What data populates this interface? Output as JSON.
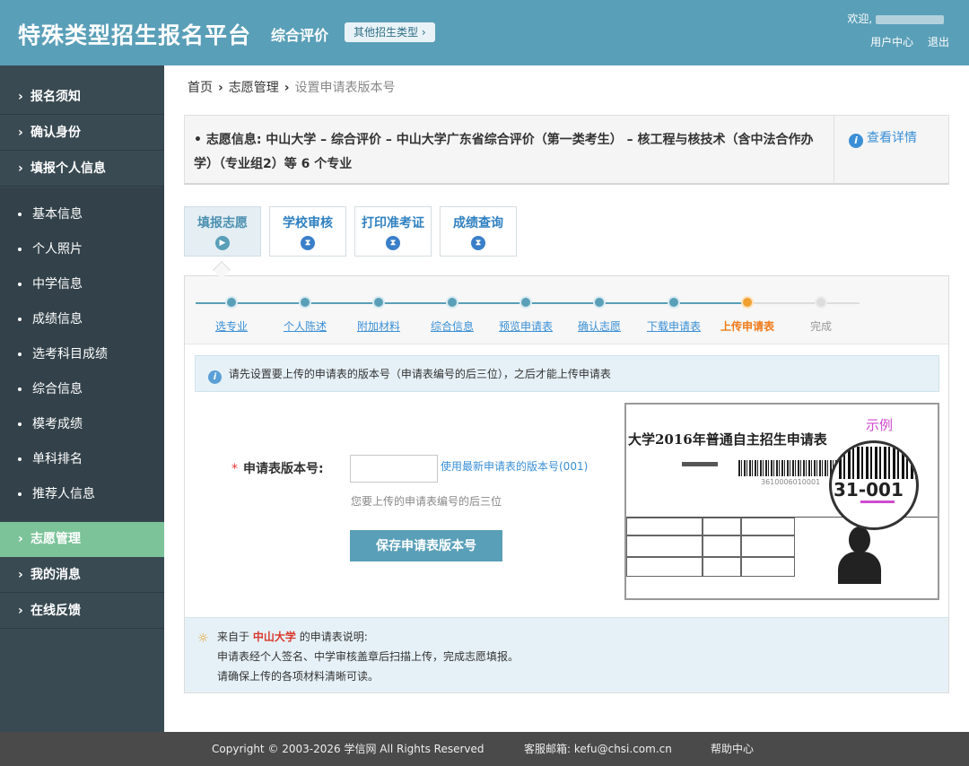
{
  "header": {
    "brand": "特殊类型招生报名平台",
    "subtitle": "综合评价",
    "other_types_button": "其他招生类型 ›",
    "welcome": "欢迎,",
    "user_center": "用户中心",
    "logout": "退出"
  },
  "sidebar": {
    "top_items": [
      {
        "label": "报名须知"
      },
      {
        "label": "确认身份"
      },
      {
        "label": "填报个人信息"
      }
    ],
    "sub_items": [
      {
        "label": "基本信息"
      },
      {
        "label": "个人照片"
      },
      {
        "label": "中学信息"
      },
      {
        "label": "成绩信息"
      },
      {
        "label": "选考科目成绩"
      },
      {
        "label": "综合信息"
      },
      {
        "label": "模考成绩"
      },
      {
        "label": "单科排名"
      },
      {
        "label": "推荐人信息"
      }
    ],
    "bottom_items": [
      {
        "label": "志愿管理",
        "active": true
      },
      {
        "label": "我的消息"
      },
      {
        "label": "在线反馈"
      }
    ]
  },
  "breadcrumb": {
    "home": "首页",
    "section": "志愿管理",
    "current": "设置申请表版本号"
  },
  "info": {
    "text": "志愿信息: 中山大学 – 综合评价 – 中山大学广东省综合评价（第一类考生） – 核工程与核技术（含中法合作办学）（专业组2）等 6 个专业",
    "detail_link": "查看详情"
  },
  "tabs": [
    {
      "label": "填报志愿",
      "active": true
    },
    {
      "label": "学校审核"
    },
    {
      "label": "打印准考证"
    },
    {
      "label": "成绩查询"
    }
  ],
  "steps": [
    {
      "label": "选专业"
    },
    {
      "label": "个人陈述"
    },
    {
      "label": "附加材料"
    },
    {
      "label": "综合信息"
    },
    {
      "label": "预览申请表"
    },
    {
      "label": "确认志愿"
    },
    {
      "label": "下载申请表"
    },
    {
      "label": "上传申请表"
    },
    {
      "label": "完成"
    }
  ],
  "notice": "请先设置要上传的申请表的版本号（申请表编号的后三位），之后才能上传申请表",
  "form": {
    "required_mark": "*",
    "label": "申请表版本号:",
    "input_value": "",
    "use_latest": "使用最新申请表的版本号(001)",
    "hint": "您要上传的申请表编号的后三位",
    "save_button": "保存申请表版本号"
  },
  "sample": {
    "tag": "示例",
    "title": "大学2016年普通自主招生申请表",
    "serial_small": "3610006010001",
    "serial_zoom": "31-001"
  },
  "footnote": {
    "prefix": "来自于",
    "university": "中山大学",
    "suffix": "的申请表说明:",
    "line1": "申请表经个人签名、中学审核盖章后扫描上传，完成志愿填报。",
    "line2": "请确保上传的各项材料清晰可读。"
  },
  "footer": {
    "copyright": "Copyright © 2003-2026 学信网 All Rights Reserved",
    "email": "客服邮箱: kefu@chsi.com.cn",
    "help": "帮助中心"
  }
}
